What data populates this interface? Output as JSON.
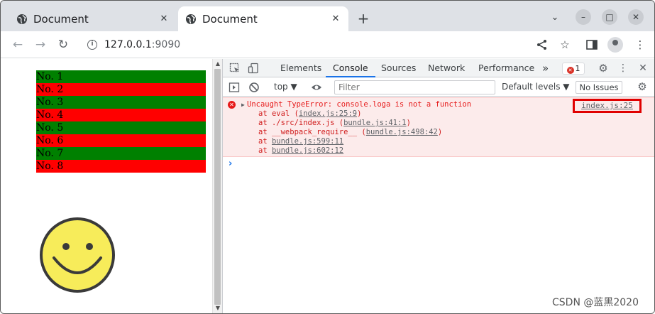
{
  "browser": {
    "tabs": [
      {
        "title": "Document",
        "active": false
      },
      {
        "title": "Document",
        "active": true
      }
    ],
    "address": {
      "host": "127.0.0.1",
      "port": ":9090"
    }
  },
  "page": {
    "list_items": [
      "No. 1",
      "No. 2",
      "No. 3",
      "No. 4",
      "No. 5",
      "No. 6",
      "No. 7",
      "No. 8"
    ],
    "colors": {
      "even": "#008000",
      "odd": "#ff0000",
      "smiley": "#f7ec5a"
    }
  },
  "devtools": {
    "tabs": [
      "Elements",
      "Console",
      "Sources",
      "Network",
      "Performance"
    ],
    "active_tab": "Console",
    "more": "»",
    "error_count": "1",
    "context": "top ▼",
    "filter_placeholder": "Filter",
    "levels": "Default levels ▼",
    "issues": "No Issues",
    "error": {
      "message": "Uncaught TypeError: console.loga is not a function",
      "source": "index.js:25",
      "stack": [
        {
          "prefix": "at eval (",
          "link": "index.js:25:9",
          "suffix": ")"
        },
        {
          "prefix": "at ./src/index.js (",
          "link": "bundle.js:41:1",
          "suffix": ")"
        },
        {
          "prefix": "at __webpack_require__ (",
          "link": "bundle.js:498:42",
          "suffix": ")"
        },
        {
          "prefix": "at ",
          "link": "bundle.js:599:11",
          "suffix": ""
        },
        {
          "prefix": "at ",
          "link": "bundle.js:602:12",
          "suffix": ""
        }
      ]
    },
    "prompt": "›"
  },
  "watermark": "CSDN @蓝黑2020"
}
